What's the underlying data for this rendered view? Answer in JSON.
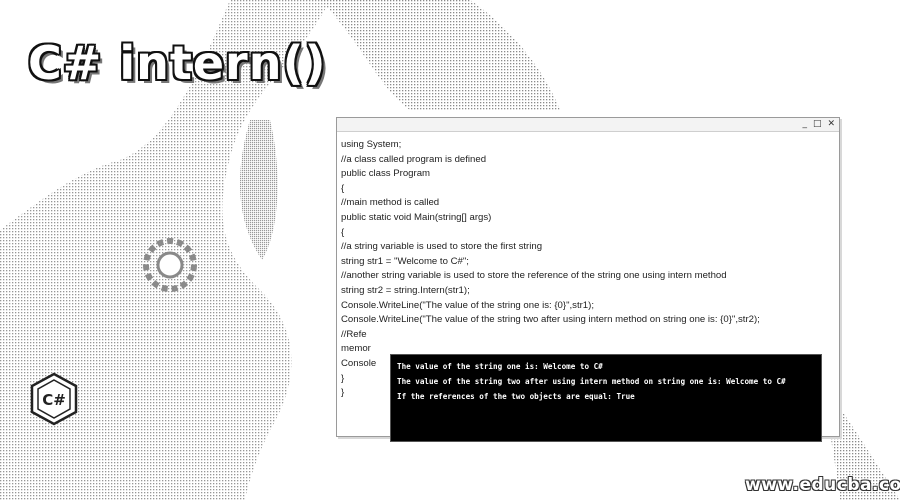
{
  "page": {
    "title": "C# intern()"
  },
  "editor": {
    "window_controls": [
      "_",
      "□",
      "✕"
    ],
    "code_lines": [
      "using System;",
      "//a class called program is defined",
      "public class Program",
      "{",
      "//main method is called",
      "public static void Main(string[] args)",
      "{",
      "//a string variable is used to store the first string",
      "string str1 = \"Welcome to C#\";",
      "//another string variable is used to store the reference of the string one using intern method",
      "string str2 = string.Intern(str1);",
      "Console.WriteLine(\"The value of the string one is: {0}\",str1);",
      "Console.WriteLine(\"The value of the string two after using intern method on string one is: {0}\",str2);",
      "//Refe",
      "memor",
      "Console",
      "}",
      "}"
    ]
  },
  "console": {
    "lines": [
      "The value of the string one is: Welcome to C#",
      "The value of the string two after using intern method on string one is: Welcome to C#",
      "If the references of the two objects are equal: True"
    ]
  },
  "logo": {
    "icon": "csharp-logo",
    "text": "C#"
  },
  "watermark": {
    "text": "www.educba.com"
  },
  "colors": {
    "console_bg": "#000000",
    "console_text": "#ffffff",
    "dither": "#8a8a8a"
  }
}
